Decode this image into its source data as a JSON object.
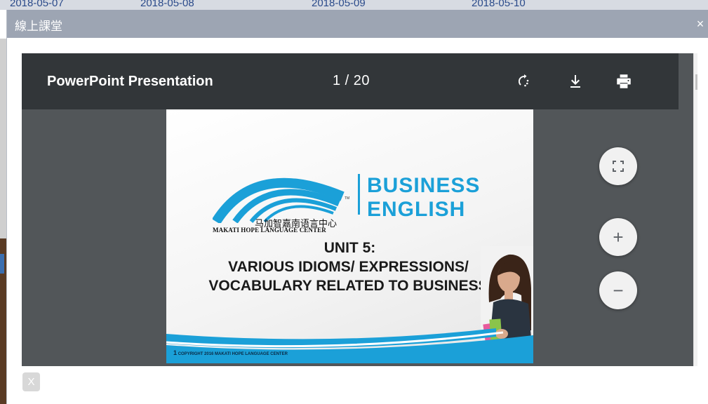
{
  "background": {
    "dates": [
      "2018-05-07",
      "2018-05-08",
      "2018-05-09",
      "2018-05-10"
    ]
  },
  "modal": {
    "title": "線上課堂",
    "close_label": "×"
  },
  "viewer": {
    "doc_title": "PowerPoint Presentation",
    "page_current": 1,
    "page_total": 20,
    "page_display": "1  /  20",
    "toolbar_icons": [
      "rotate-icon",
      "download-icon",
      "print-icon"
    ],
    "zoom_icons": [
      "fit-page-icon",
      "zoom-in-icon",
      "zoom-out-icon"
    ],
    "zoom_in_label": "+",
    "zoom_out_label": "−"
  },
  "slide": {
    "logo_cn": "马加智嘉南语言中心",
    "logo_en": "MAKATI HOPE LANGUAGE CENTER",
    "logo_tm": "TM",
    "brand_line1": "BUSINESS",
    "brand_line2": "ENGLISH",
    "unit_title": "UNIT 5:",
    "subtitle_line1": "VARIOUS IDIOMS/ EXPRESSIONS/",
    "subtitle_line2": "VOCABULARY RELATED TO BUSINESS",
    "footer_num": "1",
    "footer_text": "COPYRIGHT 2016 MAKATI HOPE LANGUAGE CENTER",
    "accent_color": "#1ba0d8"
  },
  "footer": {
    "x_label": "X"
  }
}
